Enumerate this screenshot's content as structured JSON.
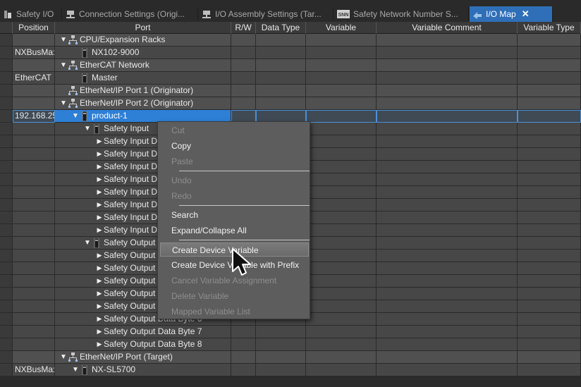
{
  "tabs": [
    {
      "label": "Safety I/O",
      "icon": "safety-io-icon",
      "active": false
    },
    {
      "label": "Connection Settings (Origi...",
      "icon": "connection-icon",
      "active": false
    },
    {
      "label": "I/O Assembly Settings (Tar...",
      "icon": "assembly-icon",
      "active": false
    },
    {
      "label": "Safety Network Number S...",
      "icon": "snn-icon",
      "active": false
    },
    {
      "label": "I/O Map",
      "icon": "io-map-icon",
      "active": true
    }
  ],
  "snn_badge": "SNN",
  "columns": {
    "position": "Position",
    "port": "Port",
    "rw": "R/W",
    "data_type": "Data Type",
    "variable": "Variable",
    "variable_comment": "Variable Comment",
    "variable_type": "Variable Type"
  },
  "rows": [
    {
      "position": "",
      "label": "CPU/Expansion Racks",
      "level": 0,
      "arrow": "down",
      "icon": "network-icon",
      "group": true
    },
    {
      "position": "NXBusMa:",
      "label": "NX102-9000",
      "level": 1,
      "arrow": "",
      "icon": "device-icon",
      "group": false
    },
    {
      "position": "",
      "label": "EtherCAT Network",
      "level": 0,
      "arrow": "down",
      "icon": "network-icon",
      "group": true
    },
    {
      "position": "EtherCAT I",
      "label": "Master",
      "level": 1,
      "arrow": "",
      "icon": "device-icon",
      "group": false
    },
    {
      "position": "",
      "label": "EtherNet/IP Port 1 (Originator)",
      "level": 0,
      "arrow": "",
      "icon": "network-icon",
      "group": true
    },
    {
      "position": "",
      "label": "EtherNet/IP Port 2 (Originator)",
      "level": 0,
      "arrow": "down",
      "icon": "network-icon",
      "group": true
    },
    {
      "position": "192.168.25",
      "label": "product-1",
      "level": 1,
      "arrow": "down",
      "icon": "device-icon",
      "group": false,
      "selected": true
    },
    {
      "position": "",
      "label": "Safety Input",
      "level": 2,
      "arrow": "down",
      "icon": "device-icon",
      "group": false
    },
    {
      "position": "",
      "label": "Safety Input Data Byte 1",
      "level": 3,
      "arrow": "right",
      "icon": "",
      "group": false
    },
    {
      "position": "",
      "label": "Safety Input Data Byte 2",
      "level": 3,
      "arrow": "right",
      "icon": "",
      "group": false
    },
    {
      "position": "",
      "label": "Safety Input Data Byte 3",
      "level": 3,
      "arrow": "right",
      "icon": "",
      "group": false
    },
    {
      "position": "",
      "label": "Safety Input Data Byte 4",
      "level": 3,
      "arrow": "right",
      "icon": "",
      "group": false
    },
    {
      "position": "",
      "label": "Safety Input Data Byte 5",
      "level": 3,
      "arrow": "right",
      "icon": "",
      "group": false
    },
    {
      "position": "",
      "label": "Safety Input Data Byte 6",
      "level": 3,
      "arrow": "right",
      "icon": "",
      "group": false
    },
    {
      "position": "",
      "label": "Safety Input Data Byte 7",
      "level": 3,
      "arrow": "right",
      "icon": "",
      "group": false
    },
    {
      "position": "",
      "label": "Safety Input Data Byte 8",
      "level": 3,
      "arrow": "right",
      "icon": "",
      "group": false
    },
    {
      "position": "",
      "label": "Safety Output",
      "level": 2,
      "arrow": "down",
      "icon": "device-icon",
      "group": false
    },
    {
      "position": "",
      "label": "Safety Output Data Byte 1",
      "level": 3,
      "arrow": "right",
      "icon": "",
      "group": false
    },
    {
      "position": "",
      "label": "Safety Output Data Byte 2",
      "level": 3,
      "arrow": "right",
      "icon": "",
      "group": false
    },
    {
      "position": "",
      "label": "Safety Output Data Byte 3",
      "level": 3,
      "arrow": "right",
      "icon": "",
      "group": false
    },
    {
      "position": "",
      "label": "Safety Output Data Byte 4",
      "level": 3,
      "arrow": "right",
      "icon": "",
      "group": false
    },
    {
      "position": "",
      "label": "Safety Output Data Byte 5",
      "level": 3,
      "arrow": "right",
      "icon": "",
      "group": false
    },
    {
      "position": "",
      "label": "Safety Output Data Byte 6",
      "level": 3,
      "arrow": "right",
      "icon": "",
      "group": false
    },
    {
      "position": "",
      "label": "Safety Output Data Byte 7",
      "level": 3,
      "arrow": "right",
      "icon": "",
      "group": false
    },
    {
      "position": "",
      "label": "Safety Output Data Byte 8",
      "level": 3,
      "arrow": "right",
      "icon": "",
      "group": false
    },
    {
      "position": "",
      "label": "EtherNet/IP Port (Target)",
      "level": 0,
      "arrow": "down",
      "icon": "network-icon",
      "group": true
    },
    {
      "position": "NXBusMa:",
      "label": "NX-SL5700",
      "level": 1,
      "arrow": "down",
      "icon": "device-icon",
      "group": false
    }
  ],
  "context_menu": {
    "items": [
      {
        "label": "Cut",
        "enabled": false
      },
      {
        "label": "Copy",
        "enabled": true
      },
      {
        "label": "Paste",
        "enabled": false
      },
      {
        "separator": true
      },
      {
        "label": "Undo",
        "enabled": false
      },
      {
        "label": "Redo",
        "enabled": false
      },
      {
        "separator": true
      },
      {
        "label": "Search",
        "enabled": true
      },
      {
        "label": "Expand/Collapse All",
        "enabled": true
      },
      {
        "separator": true
      },
      {
        "label": "Create Device Variable",
        "enabled": true,
        "highlighted": true
      },
      {
        "label": "Create Device Variable with Prefix",
        "enabled": true
      },
      {
        "label": "Cancel Variable Assignment",
        "enabled": false
      },
      {
        "label": "Delete Variable",
        "enabled": false
      },
      {
        "label": "Mapped Variable List",
        "enabled": false
      }
    ]
  },
  "colors": {
    "active_tab": "#2f6fb8",
    "selected_row": "#2e7fd6",
    "menu_bg": "#5d5d5d"
  }
}
